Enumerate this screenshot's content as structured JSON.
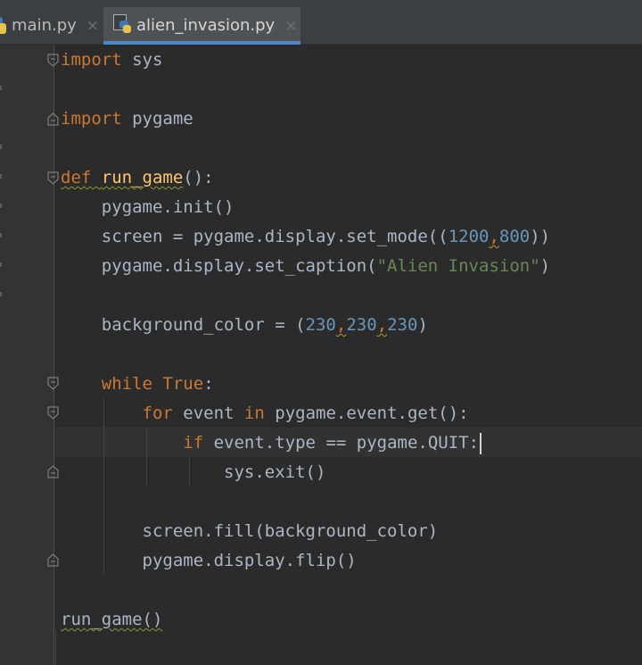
{
  "tabs": [
    {
      "label": "main.py",
      "close": "×",
      "icon": "python-file-icon",
      "active": false
    },
    {
      "label": "alien_invasion.py",
      "close": "×",
      "icon": "python-file-icon",
      "active": true
    }
  ],
  "colors": {
    "background": "#2b2b2b",
    "gutter": "#313335",
    "keyword": "#cc7832",
    "function": "#ffc66d",
    "number": "#6897bb",
    "string": "#6a8759",
    "text": "#a9b7c6",
    "tab_underline": "#4a88c7"
  },
  "code": {
    "l1": {
      "kw": "import",
      "rest": " sys"
    },
    "l2": {
      "kw": "import",
      "rest": " pygame"
    },
    "l3": {
      "kw": "def",
      "sp": " ",
      "fn": "run_game",
      "rest": "():"
    },
    "l4": {
      "text": "    pygame.init()"
    },
    "l5": {
      "a": "    screen = pygame.display.set_mode((",
      "n1": "1200",
      "c": ",",
      "n2": "800",
      "b": "))"
    },
    "l6": {
      "a": "    pygame.display.set_caption(",
      "s": "\"Alien Invasion\"",
      "b": ")"
    },
    "l7": {
      "a": "    background_color = (",
      "n1": "230",
      "c1": ",",
      "n2": "230",
      "c2": ",",
      "n3": "230",
      "b": ")"
    },
    "l8": {
      "indent": "    ",
      "kw1": "while",
      "sp": " ",
      "kw2": "True",
      "rest": ":"
    },
    "l9": {
      "indent": "        ",
      "kw1": "for",
      "mid": " event ",
      "kw2": "in",
      "rest": " pygame.event.get():"
    },
    "l10": {
      "indent": "            ",
      "kw": "if",
      "rest": " event.type == pygame.QUIT:"
    },
    "l11": {
      "text": "                sys.exit()"
    },
    "l12": {
      "text": "        screen.fill(background_color)"
    },
    "l13": {
      "text": "        pygame.display.flip()"
    },
    "l14": {
      "text": "run_game()"
    }
  }
}
